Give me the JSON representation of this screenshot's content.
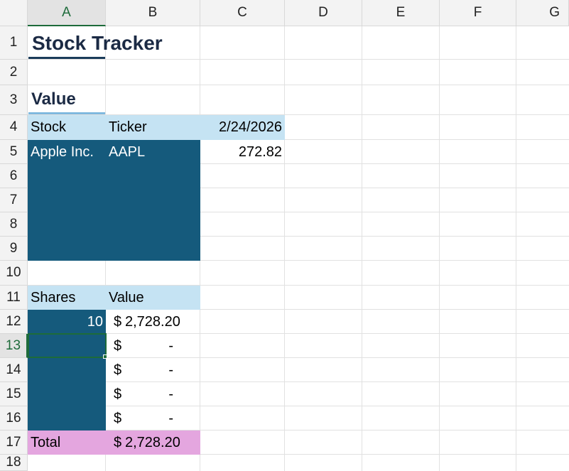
{
  "columns": [
    "A",
    "B",
    "C",
    "D",
    "E",
    "F",
    "G"
  ],
  "rows": [
    "1",
    "2",
    "3",
    "4",
    "5",
    "6",
    "7",
    "8",
    "9",
    "10",
    "11",
    "12",
    "13",
    "14",
    "15",
    "16",
    "17",
    "18"
  ],
  "selected_cell": "A13",
  "sheet": {
    "title": "Stock Tracker",
    "value_heading": "Value",
    "header_row": {
      "stock": "Stock",
      "ticker": "Ticker",
      "date": "2/24/2026"
    },
    "stock_row": {
      "stock": "Apple Inc.",
      "ticker": "AAPL",
      "price": "272.82"
    },
    "shares_header": {
      "shares": "Shares",
      "value": "Value"
    },
    "shares_rows": [
      {
        "shares": "10",
        "currency": "$",
        "value": "2,728.20"
      },
      {
        "shares": "",
        "currency": "$",
        "value": "-"
      },
      {
        "shares": "",
        "currency": "$",
        "value": "-"
      },
      {
        "shares": "",
        "currency": "$",
        "value": "-"
      },
      {
        "shares": "",
        "currency": "$",
        "value": "-"
      }
    ],
    "total": {
      "label": "Total",
      "currency": "$",
      "value": "2,728.20"
    }
  },
  "colors": {
    "header_fill": "#c5e3f3",
    "input_fill": "#155a7c",
    "total_fill": "#e4a6df",
    "title_text": "#1b2a44",
    "selection": "#1d6b3a"
  }
}
